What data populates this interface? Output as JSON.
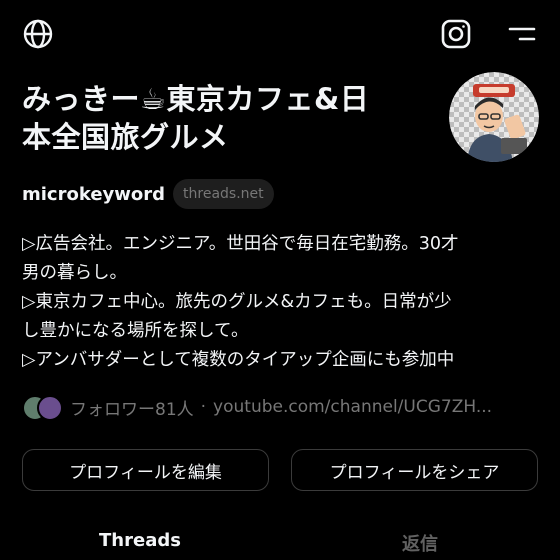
{
  "header": {
    "left_icon": "globe-icon",
    "right_icons": [
      "instagram-icon",
      "menu-icon"
    ]
  },
  "profile": {
    "display_name_line1": "みっきー☕東京カフェ&日",
    "display_name_line2": "本全国旅グルメ",
    "handle": "microkeyword",
    "domain_chip": "threads.net",
    "bio_lines": [
      "▷広告会社。エンジニア。世田谷で毎日在宅勤務。30才",
      "男の暮らし。",
      "▷東京カフェ中心。旅先のグルメ&カフェも。日常が少",
      "し豊かになる場所を探して。",
      "▷アンバサダーとして複数のタイアップ企画にも参加中"
    ],
    "followers_text": "フォロワー81人",
    "separator": "·",
    "link_text": "youtube.com/channel/UCG7ZH..."
  },
  "actions": {
    "edit_profile": "プロフィールを編集",
    "share_profile": "プロフィールをシェア"
  },
  "tabs": {
    "threads": "Threads",
    "replies": "返信"
  },
  "colors": {
    "background": "#000000",
    "primary_text": "#f3f5f7",
    "secondary_text": "#777777",
    "button_border": "#3b3b3b"
  }
}
